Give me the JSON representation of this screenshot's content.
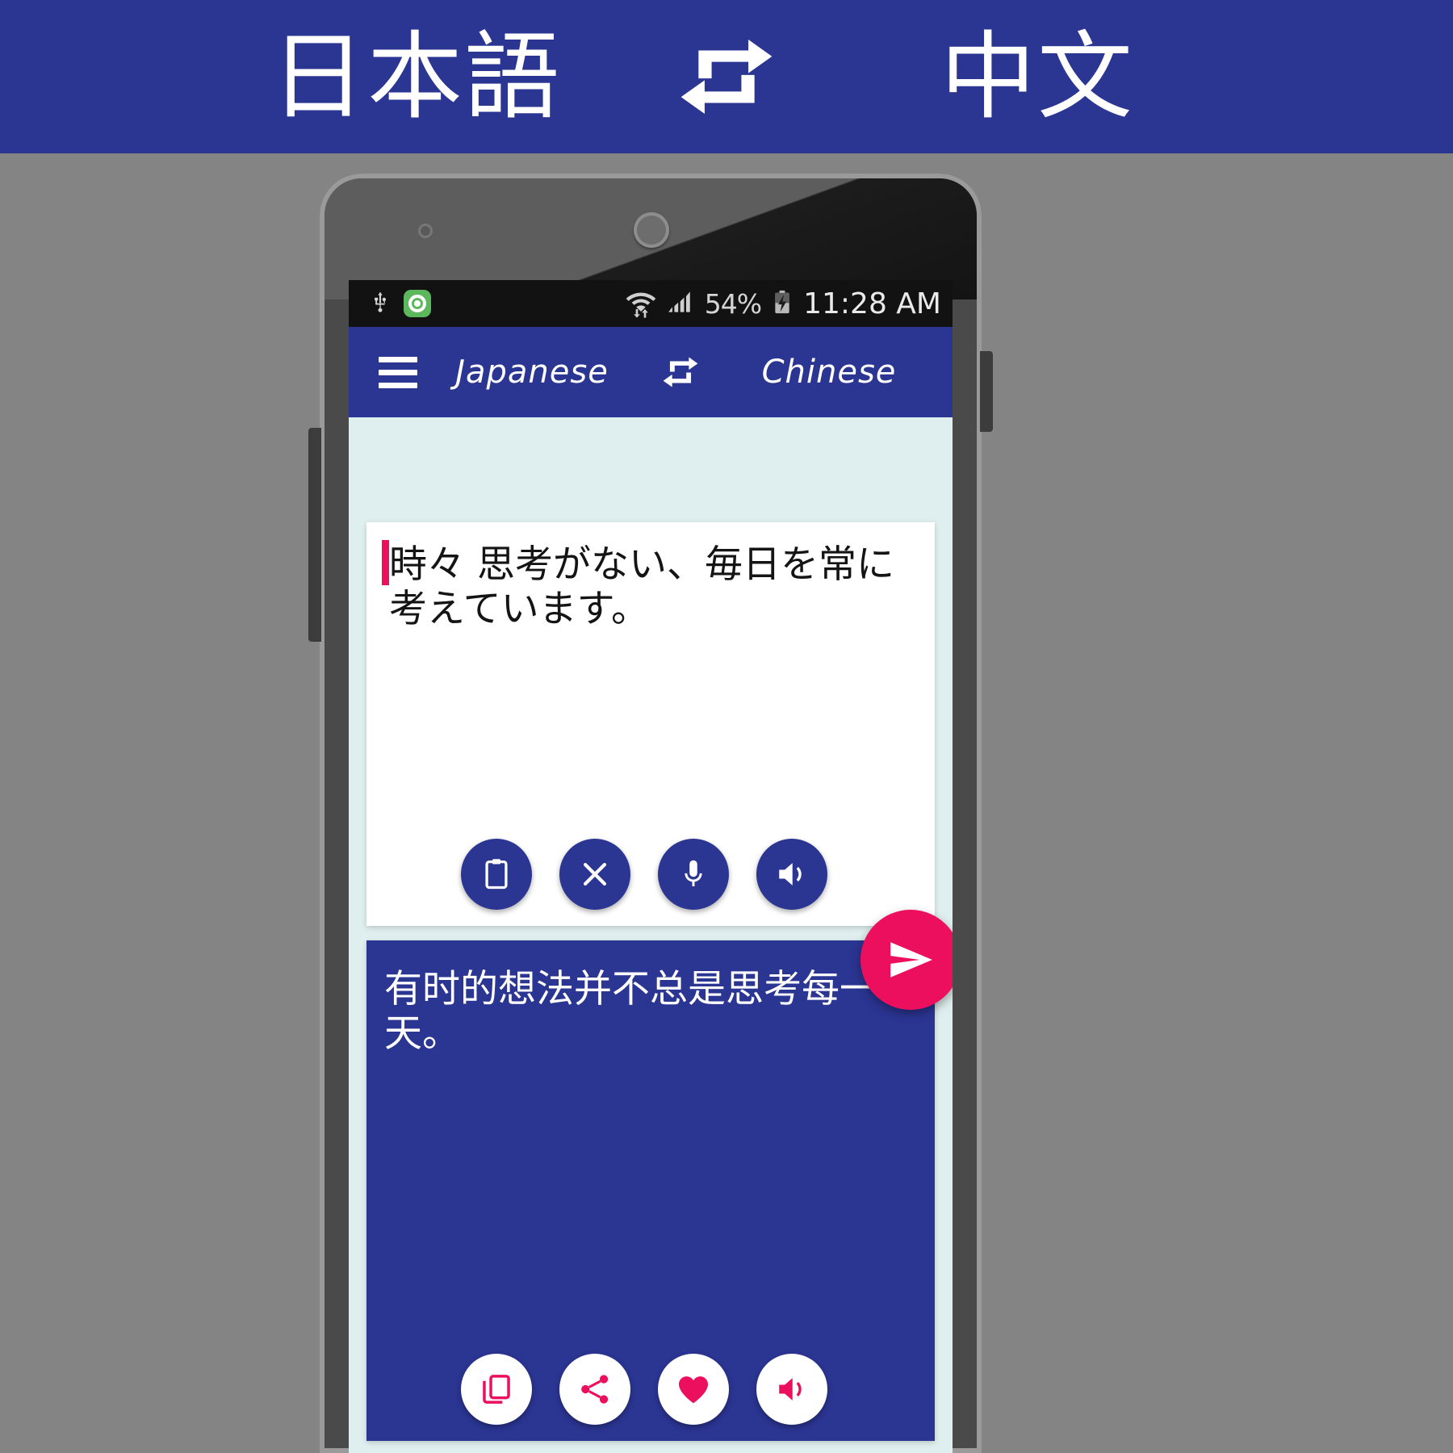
{
  "banner": {
    "source_language": "日本語",
    "target_language": "中文",
    "swap_icon": "swap-arrows-icon",
    "background_color": "#2b3592",
    "text_color": "#ffffff"
  },
  "phone": {
    "status_bar": {
      "usb_icon": "usb-icon",
      "app_icon": "green-app-icon",
      "wifi_icon": "wifi-data-icon",
      "signal_icon": "cellular-signal-icon",
      "battery_percent": "54%",
      "battery_icon": "battery-charging-icon",
      "time": "11:28 AM",
      "background_color": "#121212"
    },
    "toolbar": {
      "menu_icon": "hamburger-menu-icon",
      "source_language": "Japanese",
      "swap_icon": "swap-arrows-icon",
      "target_language": "Chinese",
      "background_color": "#2b3592"
    },
    "source_panel": {
      "text": "時々 思考がない、毎日を常に考えています。",
      "caret_color": "#ec0f5e",
      "background_color": "#ffffff",
      "actions": [
        {
          "name": "paste",
          "icon": "clipboard-icon",
          "style": "blue"
        },
        {
          "name": "clear",
          "icon": "close-x-icon",
          "style": "blue"
        },
        {
          "name": "voice-input",
          "icon": "microphone-icon",
          "style": "blue"
        },
        {
          "name": "speak-source",
          "icon": "speaker-icon",
          "style": "blue"
        }
      ]
    },
    "translate_button": {
      "icon": "send-icon",
      "color": "#ec0f5e"
    },
    "target_panel": {
      "text": "有时的想法并不总是思考每一天。",
      "background_color": "#2b3592",
      "actions": [
        {
          "name": "copy",
          "icon": "copy-icon",
          "style": "white"
        },
        {
          "name": "share",
          "icon": "share-icon",
          "style": "white"
        },
        {
          "name": "favorite",
          "icon": "heart-icon",
          "style": "white"
        },
        {
          "name": "speak-target",
          "icon": "speaker-icon",
          "style": "white"
        }
      ]
    }
  }
}
